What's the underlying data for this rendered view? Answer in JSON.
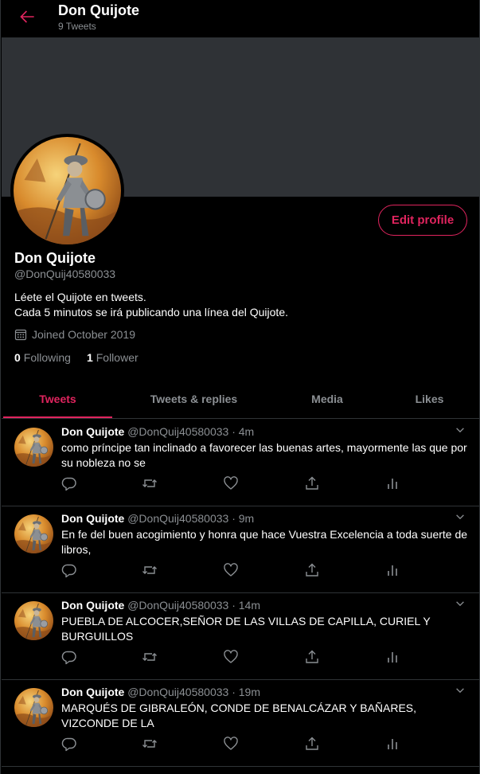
{
  "header": {
    "title": "Don Quijote",
    "subtitle": "9 Tweets"
  },
  "profile": {
    "name": "Don Quijote",
    "handle": "@DonQuij40580033",
    "bio_line1": "Léete el Quijote en tweets.",
    "bio_line2": "Cada 5 minutos se irá publicando una línea del Quijote.",
    "joined": "Joined October 2019",
    "following_count": "0",
    "following_label": "Following",
    "followers_count": "1",
    "followers_label": "Follower",
    "edit_label": "Edit profile"
  },
  "tabs": [
    {
      "label": "Tweets",
      "active": true
    },
    {
      "label": "Tweets & replies",
      "active": false
    },
    {
      "label": "Media",
      "active": false
    },
    {
      "label": "Likes",
      "active": false
    }
  ],
  "tweets": [
    {
      "name": "Don Quijote",
      "handle": "@DonQuij40580033",
      "sep": "·",
      "time": "4m",
      "text": "como príncipe tan inclinado a favorecer las buenas artes, mayormente las que por su nobleza no se"
    },
    {
      "name": "Don Quijote",
      "handle": "@DonQuij40580033",
      "sep": "·",
      "time": "9m",
      "text": "En fe del buen acogimiento y honra que hace Vuestra Excelencia a toda suerte de libros,"
    },
    {
      "name": "Don Quijote",
      "handle": "@DonQuij40580033",
      "sep": "·",
      "time": "14m",
      "text": "PUEBLA DE ALCOCER,SEÑOR DE LAS VILLAS DE CAPILLA, CURIEL Y BURGUILLOS"
    },
    {
      "name": "Don Quijote",
      "handle": "@DonQuij40580033",
      "sep": "·",
      "time": "19m",
      "text": "MARQUÉS DE GIBRALEÓN, CONDE DE BENALCÁZAR Y BAÑARES, VIZCONDE DE LA"
    }
  ],
  "colors": {
    "accent": "#e0245e",
    "muted": "#8b8f93",
    "banner": "#2f3236",
    "border": "#2f3336"
  },
  "icons": [
    "back-arrow-icon",
    "calendar-icon",
    "chevron-down-icon",
    "reply-icon",
    "retweet-icon",
    "like-icon",
    "share-icon",
    "analytics-icon"
  ]
}
